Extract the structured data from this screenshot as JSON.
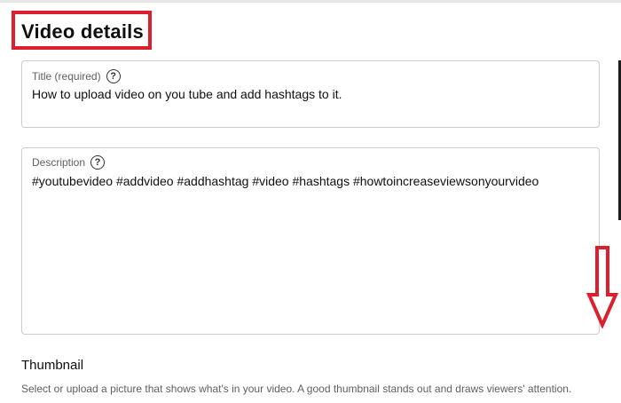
{
  "header": {
    "title": "Video details"
  },
  "form": {
    "title_field": {
      "label": "Title (required)",
      "value": "How to upload video on you tube and add hashtags to it."
    },
    "description_field": {
      "label": "Description",
      "value": "#youtubevideo #addvideo #addhashtag #video #hashtags #howtoincreaseviewsonyourvideo"
    }
  },
  "thumbnail": {
    "heading": "Thumbnail",
    "description": "Select or upload a picture that shows what's in your video. A good thumbnail stands out and draws viewers' attention."
  },
  "annotations": {
    "highlight_color": "#dc1e2d",
    "arrow_direction": "down"
  },
  "icons": {
    "help": "help-circle-icon"
  },
  "colors": {
    "text": "#0f0f0f",
    "secondary_text": "#606060",
    "border": "#cccccc"
  }
}
